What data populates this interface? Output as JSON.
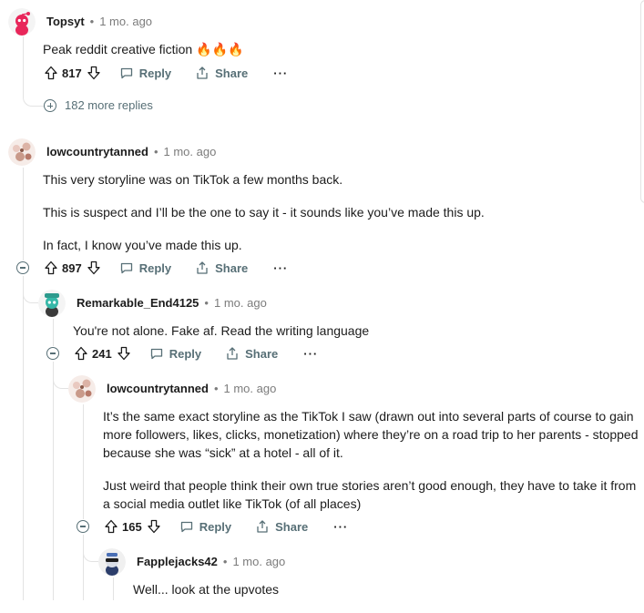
{
  "comments": [
    {
      "author": "Topsyt",
      "time": "1 mo. ago",
      "body": [
        "Peak reddit creative fiction 🔥🔥🔥"
      ],
      "score": "817",
      "more_replies": "182 more replies"
    },
    {
      "author": "lowcountrytanned",
      "time": "1 mo. ago",
      "body": [
        "This very storyline was on TikTok a few months back.",
        "This is suspect and I’ll be the one to say it - it sounds like you’ve made this up.",
        "In fact, I know you’ve made this up."
      ],
      "score": "897"
    },
    {
      "author": "Remarkable_End4125",
      "time": "1 mo. ago",
      "body": [
        "You're not alone. Fake af. Read the writing language"
      ],
      "score": "241"
    },
    {
      "author": "lowcountrytanned",
      "time": "1 mo. ago",
      "body": [
        "It’s the same exact storyline as the TikTok I saw (drawn out into several parts of course to gain more followers, likes, clicks, monetization) where they’re on a road trip to her parents - stopped because she was “sick” at a hotel - all of it.",
        "Just weird that people think their own true stories aren’t good enough, they have to take it from a social media outlet like TikTok (of all places)"
      ],
      "score": "165"
    },
    {
      "author": "Fapplejacks42",
      "time": "1 mo. ago",
      "body": [
        "Well... look at the upvotes"
      ]
    }
  ],
  "labels": {
    "reply": "Reply",
    "share": "Share",
    "overflow": "···",
    "separator": "•"
  },
  "colors": {
    "meta_grey": "#7c7c7c",
    "action_grey": "#576f76",
    "thread_line": "#e3e3e3",
    "snoo_pink": "#e8265a"
  },
  "icons": [
    "upvote-icon",
    "downvote-icon",
    "comment-icon",
    "share-icon",
    "collapse-icon",
    "expand-icon",
    "overflow-icon"
  ]
}
